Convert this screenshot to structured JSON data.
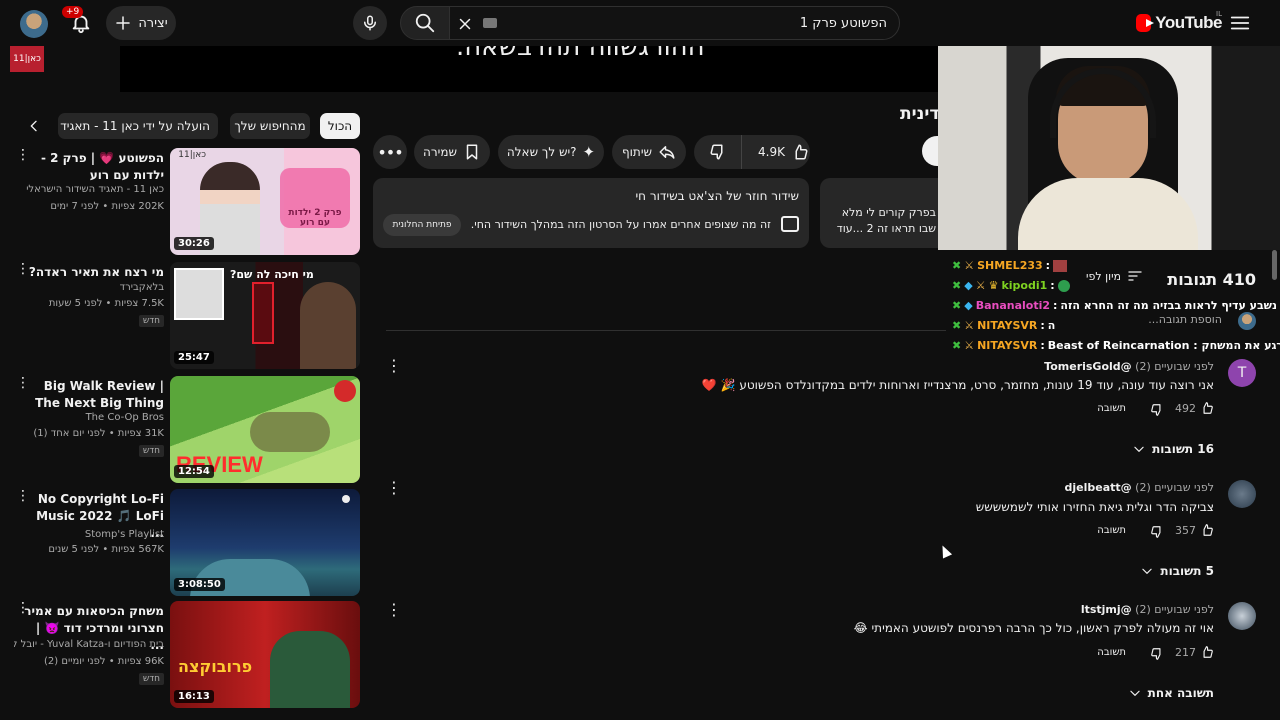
{
  "header": {
    "logo_text": "YouTube",
    "region": "IL",
    "search_value": "הפשוטע פרק 1",
    "create_label": "יצירה",
    "notifications_count": "+9"
  },
  "video": {
    "watermark": "כאן|11",
    "banner_text": "ההורגשווה תהדבשאה.",
    "title_partial": "דינית"
  },
  "chips": [
    {
      "label": "הכול"
    },
    {
      "label": "מהחיפוש שלך"
    },
    {
      "label": "הועלה על ידי כאן 11 - תאגיד השי"
    }
  ],
  "actions": {
    "likes": "4.9K",
    "share": "שיתוף",
    "ask": "יש לך שאלה?",
    "save": "שמירה"
  },
  "live_chat_card": {
    "title": "שידור חוזר של הצ'אט בשידור חי",
    "body": "זה מה שצופים אחרים אמרו על הסרטון הזה במהלך השידור החי.",
    "open_button": "פתיחת החלונית"
  },
  "description_card": {
    "line1": "בפרק קורים לי מלא",
    "line2": "שבו תראו זה 2 ...עוד"
  },
  "recommendations": [
    {
      "title": "הפשוטע 💗 | פרק 2 - ילדות עם רוע",
      "channel": "כאן 11 - תאגיד השידור הישראלי",
      "stats": "202K צפיות • לפני 7 ימים",
      "duration": "30:26",
      "badge": "",
      "thumb_text": "פרק 2 ילדות עם רוע"
    },
    {
      "title": "מי רצח את תאיר ראדה?",
      "channel": "בלאקבירד",
      "stats": "7.5K צפיות • לפני 5 שעות",
      "duration": "25:47",
      "badge": "חדש",
      "thumb_text": "מי חיכה לה שם?"
    },
    {
      "title": "Big Walk Review | The Next Big Thing",
      "channel": "The Co-Op Bros",
      "stats": "31K צפיות • לפני יום אחד (1)",
      "duration": "12:54",
      "badge": "חדש",
      "thumb_text": "REVIEW"
    },
    {
      "title": "No Copyright Lo-Fi Music 2022 🎵 LoFi ...",
      "channel": "Stomp's Playlist",
      "stats": "567K צפיות • לפני 5 שנים",
      "duration": "3:08:50",
      "badge": "",
      "thumb_text": ""
    },
    {
      "title": "משחק הכיסאות עם אמיר חצרוני ומרדכי דוד 👿 | ...",
      "channel": "בית הפודיום ו-Yuval Katza - יובל קצה",
      "stats": "96K צפיות • לפני יומיים (2)",
      "duration": "16:13",
      "badge": "חדש",
      "thumb_text": "פרובוקצה"
    }
  ],
  "comments_header": {
    "count": "410 תגובות",
    "sort": "מיון לפי",
    "add_placeholder": "הוספת תגובה..."
  },
  "chat_overlay": [
    {
      "name": "SHMEL233",
      "text": "",
      "color": "#f5a623"
    },
    {
      "name": "kipodi1",
      "text": "",
      "color": "#7ed321"
    },
    {
      "name": "Bananaloti2",
      "text": "נשבע עדיף לראות בבזיה מה זה החרא הזה",
      "color": "#e94ec0"
    },
    {
      "name": "NITAYSVR",
      "text": "ה",
      "color": "#f5a623"
    },
    {
      "name": "NITAYSVR",
      "text": "עודד תבדוק רגע את המשחק : Beast of Reincarnation",
      "color": "#f5a623"
    }
  ],
  "comments": [
    {
      "author": "@TomerisGold",
      "time": "לפני שבועיים (2)",
      "text": "אני רוצה עוד עונה, עוד 19 עונות, מחזמר, סרט, מרצנדייז וארוחות ילדים במקדונלדס הפשוטע 🎉 ❤️",
      "likes": "492",
      "reply": "תשובה",
      "replies": "16 תשובות",
      "avatar_letter": "T",
      "avatar_color": "#8e44ad"
    },
    {
      "author": "@djelbeatt",
      "time": "לפני שבועיים (2)",
      "text": "צביקה הדר וגלית גיאת החזירו אותי לשמשששש",
      "likes": "357",
      "reply": "תשובה",
      "replies": "5 תשובות",
      "avatar_letter": "",
      "avatar_color": "#3a4a5a"
    },
    {
      "author": "@ltstjmj",
      "time": "לפני שבועיים (2)",
      "text": "אוי זה מעולה לפרק ראשון, כול כך הרבה רפרנסים לפושטע האמיתי 😂",
      "likes": "217",
      "reply": "תשובה",
      "replies": "תשובה אחת",
      "avatar_letter": "",
      "avatar_color": "#556"
    }
  ]
}
